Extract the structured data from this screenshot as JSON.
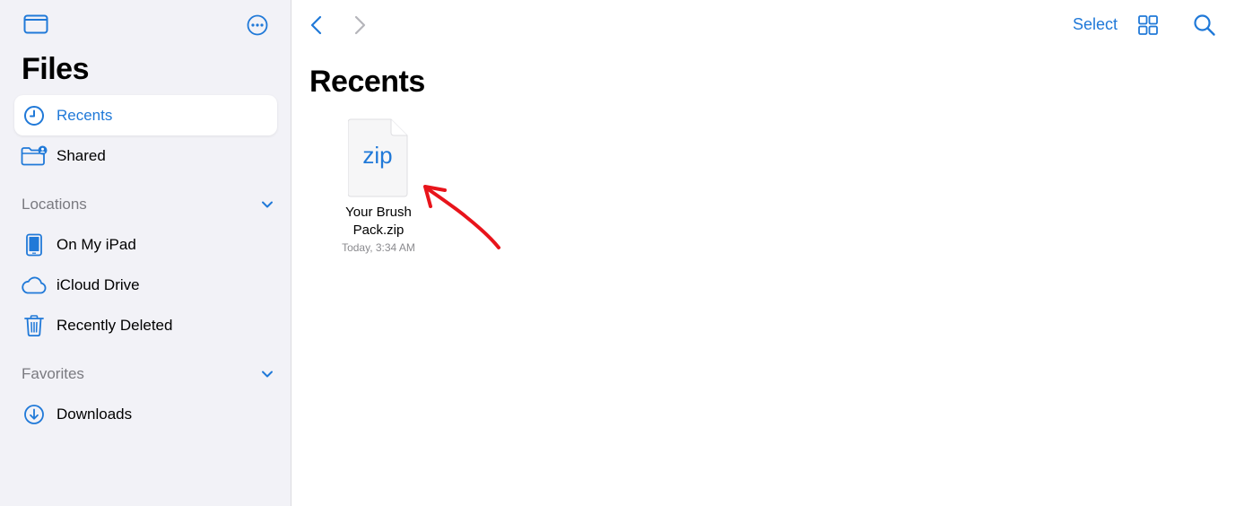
{
  "sidebar": {
    "title": "Files",
    "favorites_items": [
      {
        "label": "Recents",
        "icon": "clock-icon",
        "active": true
      },
      {
        "label": "Shared",
        "icon": "shared-folder-icon",
        "active": false
      }
    ],
    "locations": {
      "header": "Locations",
      "items": [
        {
          "label": "On My iPad",
          "icon": "ipad-icon"
        },
        {
          "label": "iCloud Drive",
          "icon": "cloud-icon"
        },
        {
          "label": "Recently Deleted",
          "icon": "trash-icon"
        }
      ]
    },
    "favorites": {
      "header": "Favorites",
      "items": [
        {
          "label": "Downloads",
          "icon": "download-icon"
        }
      ]
    }
  },
  "toolbar": {
    "select_label": "Select"
  },
  "main": {
    "title": "Recents",
    "files": [
      {
        "ext": "zip",
        "name": "Your Brush Pack.zip",
        "date": "Today, 3:34 AM"
      }
    ]
  },
  "colors": {
    "accent": "#2079d8",
    "sidebar_bg": "#f2f2f7",
    "annotation_arrow": "#e8141b"
  }
}
